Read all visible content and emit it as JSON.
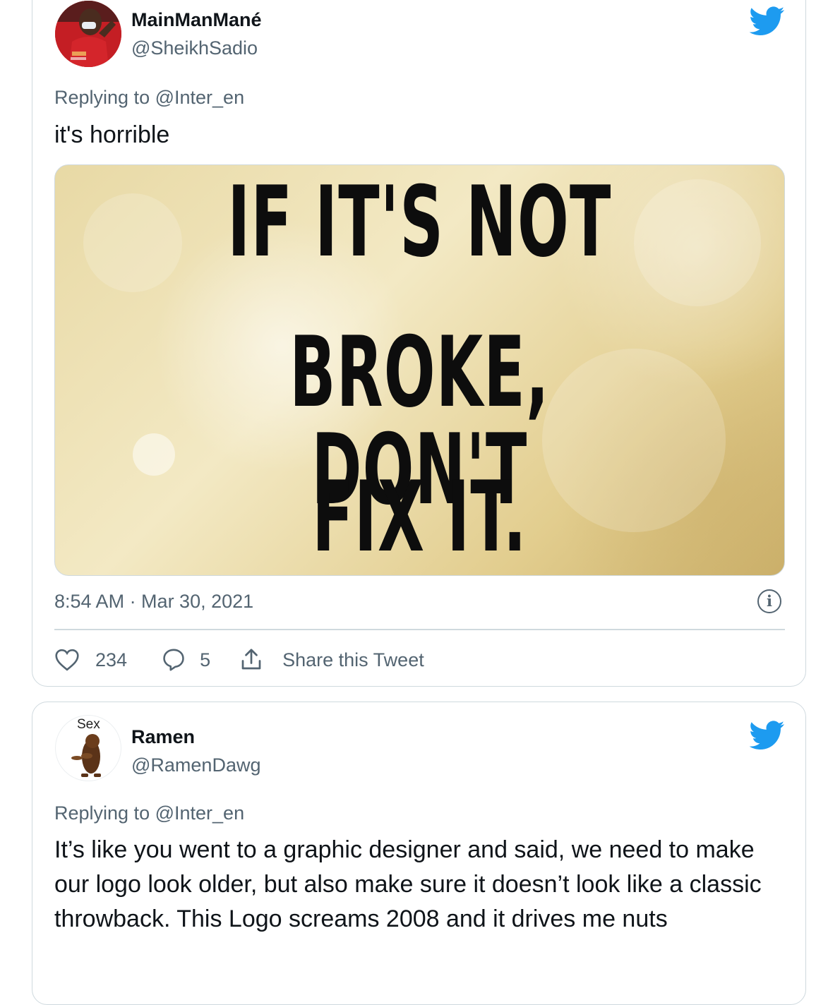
{
  "tweets": [
    {
      "display_name": "MainManMané",
      "handle": "@SheikhSadio",
      "replying_prefix": "Replying to",
      "replying_to": "@Inter_en",
      "text": "it's horrible",
      "media_text": [
        "IF IT'S NOT",
        "BROKE, DON'T",
        "FIX IT."
      ],
      "timestamp": "8:54 AM · Mar 30, 2021",
      "likes": "234",
      "replies": "5",
      "share_label": "Share this Tweet",
      "info_icon": "i"
    },
    {
      "display_name": "Ramen",
      "handle": "@RamenDawg",
      "avatar_caption": "Sex",
      "replying_prefix": "Replying to",
      "replying_to": "@Inter_en",
      "text": "It’s like you went to a graphic designer and said, we need to make our logo look older, but also make sure it doesn’t look like a classic throwback. This Logo screams 2008 and it drives me nuts"
    }
  ],
  "colors": {
    "twitter_blue": "#1d9bf0",
    "secondary_text": "#536471",
    "border": "#cfd9de"
  },
  "icons": [
    "twitter-bird-icon",
    "heart-icon",
    "reply-bubble-icon",
    "share-icon",
    "info-icon"
  ]
}
